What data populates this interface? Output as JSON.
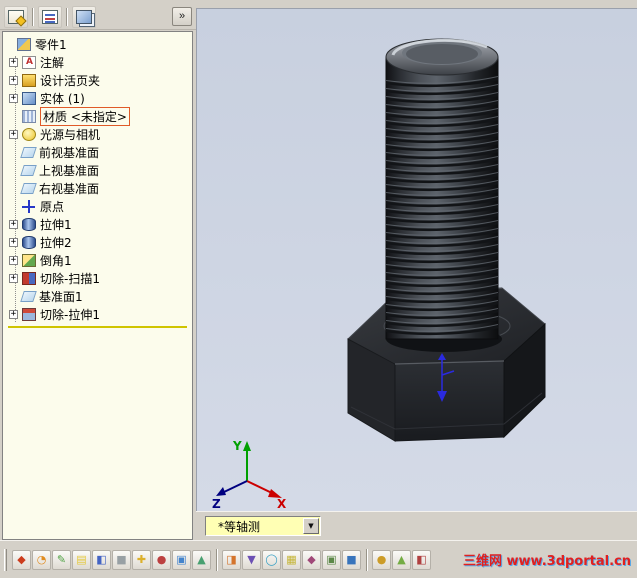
{
  "top_toolbar": {
    "expand_label": "»",
    "buttons": [
      {
        "name": "panel-toolbar-button-1"
      },
      {
        "name": "panel-toolbar-button-2"
      },
      {
        "name": "panel-toolbar-button-3"
      }
    ]
  },
  "feature_tree": {
    "root_label": "零件1",
    "items": [
      {
        "label": "注解",
        "icon": "annotations",
        "expandable": true
      },
      {
        "label": "设计活页夹",
        "icon": "design-binder",
        "expandable": true
      },
      {
        "label": "实体 (1)",
        "icon": "solid-bodies",
        "expandable": true
      },
      {
        "label": "材质 <未指定>",
        "icon": "material",
        "expandable": false,
        "highlighted": true
      },
      {
        "label": "光源与相机",
        "icon": "lights-cameras",
        "expandable": true
      },
      {
        "label": "前视基准面",
        "icon": "plane",
        "expandable": false
      },
      {
        "label": "上视基准面",
        "icon": "plane",
        "expandable": false
      },
      {
        "label": "右视基准面",
        "icon": "plane",
        "expandable": false
      },
      {
        "label": "原点",
        "icon": "origin",
        "expandable": false
      },
      {
        "label": "拉伸1",
        "icon": "extrude",
        "expandable": true
      },
      {
        "label": "拉伸2",
        "icon": "extrude",
        "expandable": true
      },
      {
        "label": "倒角1",
        "icon": "chamfer",
        "expandable": true
      },
      {
        "label": "切除-扫描1",
        "icon": "cut-sweep",
        "expandable": true
      },
      {
        "label": "基准面1",
        "icon": "plane",
        "expandable": false
      },
      {
        "label": "切除-拉伸1",
        "icon": "cut-extrude",
        "expandable": true
      }
    ]
  },
  "viewport": {
    "view_orientation": "*等轴测",
    "model_name": "hex-bolt",
    "triad": {
      "x_label": "X",
      "y_label": "Y",
      "z_label": "Z"
    }
  },
  "bottom_toolbar": {
    "icons": [
      {
        "glyph": "◆",
        "color": "#cc3c1c"
      },
      {
        "glyph": "◔",
        "color": "#e08c20"
      },
      {
        "glyph": "✎",
        "color": "#4ca040"
      },
      {
        "glyph": "▤",
        "color": "#e4c83c"
      },
      {
        "glyph": "◧",
        "color": "#4464c4"
      },
      {
        "glyph": "■",
        "color": "#98a0a4"
      },
      {
        "glyph": "✚",
        "color": "#dcb02c"
      },
      {
        "glyph": "●",
        "color": "#bc4040"
      },
      {
        "glyph": "▣",
        "color": "#4484cc"
      },
      {
        "glyph": "▲",
        "color": "#48a070"
      },
      {
        "glyph": "◨",
        "color": "#d4742c"
      },
      {
        "glyph": "▼",
        "color": "#6c50b4"
      },
      {
        "glyph": "◯",
        "color": "#38a0c4"
      },
      {
        "glyph": "▦",
        "color": "#c4b434"
      },
      {
        "glyph": "◆",
        "color": "#a04878"
      },
      {
        "glyph": "▣",
        "color": "#5c8848"
      },
      {
        "glyph": "■",
        "color": "#3874bc"
      },
      {
        "glyph": "●",
        "color": "#cc9c28"
      },
      {
        "glyph": "▲",
        "color": "#74ac44"
      },
      {
        "glyph": "◧",
        "color": "#b04040"
      }
    ],
    "separators_after": [
      9,
      16
    ]
  },
  "watermark": "三维网 www.3dportal.cn",
  "colors": {
    "chrome": "#d4d0c8",
    "tree_bg": "#fcfcec",
    "viewport_top": "#c8d0df",
    "viewport_bottom": "#d4dae7",
    "rollback": "#cfc400",
    "highlight_box": "#e05a28",
    "combo_bg": "#ffffb4",
    "watermark_color": "#e02020"
  }
}
